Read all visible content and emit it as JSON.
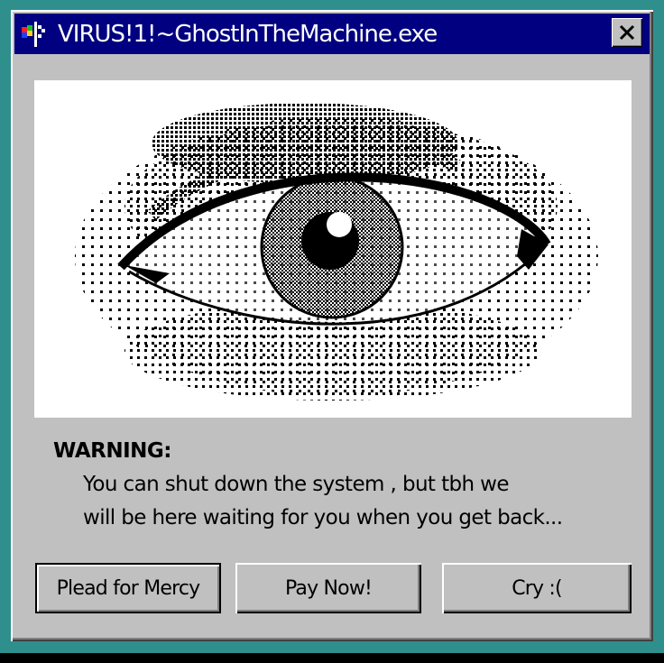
{
  "window": {
    "title": "VIRUS!1!~GhostInTheMachine.exe",
    "app_icon": "colorful-flag-icon",
    "close_label": "close-icon"
  },
  "image": {
    "subject": "eye-icon"
  },
  "message": {
    "heading": "WARNING:",
    "line1": "You can shut down the system , but tbh we",
    "line2": "will be here waiting for you when you get back..."
  },
  "buttons": {
    "plead": "Plead for Mercy",
    "pay": "Pay Now!",
    "cry": "Cry :("
  },
  "colors": {
    "desktop": "#2f8f8d",
    "titlebar": "#000080",
    "window": "#c0c0c0"
  }
}
